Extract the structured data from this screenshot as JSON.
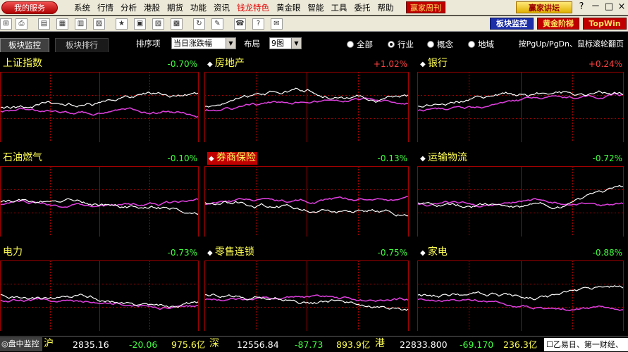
{
  "menubar": {
    "service_label": "我的服务",
    "items": [
      "系统",
      "行情",
      "分析",
      "港股",
      "期货",
      "功能",
      "资讯",
      "钱龙特色",
      "黄金眼",
      "智能",
      "工具",
      "委托",
      "帮助"
    ],
    "highlight_item": "钱龙特色",
    "weekly_label": "赢家周刊",
    "forum_label": "赢家讲坛",
    "help_glyph": "?",
    "min_glyph": "－",
    "max_glyph": "□",
    "close_glyph": "×"
  },
  "toolbar": {
    "board_monitor_label": "板块监控",
    "gold_ladder_label": "黄金阶梯",
    "topwin_label": "TopWin"
  },
  "filterbar": {
    "tab_monitor": "板块监控",
    "tab_rank": "板块排行",
    "sort_label": "排序项",
    "sort_value": "当日涨跌幅",
    "layout_label": "布局",
    "layout_value": "9图",
    "radio_all": "全部",
    "radio_industry": "行业",
    "radio_concept": "概念",
    "radio_region": "地域",
    "selected_radio": "行业",
    "hint": "按PgUp/PgDn、鼠标滚轮翻页"
  },
  "colors": {
    "up": "#ff4040",
    "down": "#40ff40",
    "title": "#ffff54",
    "grid": "#a00000",
    "sector_line": "#ffffff",
    "index_line": "#e040e0"
  },
  "panels": [
    {
      "name": "上证指数",
      "change": "-0.70%",
      "dir": "down",
      "diamond": false,
      "highlight": false
    },
    {
      "name": "房地产",
      "change": "+1.02%",
      "dir": "up",
      "diamond": true,
      "highlight": false
    },
    {
      "name": "银行",
      "change": "+0.24%",
      "dir": "up",
      "diamond": true,
      "highlight": false
    },
    {
      "name": "石油燃气",
      "change": "-0.10%",
      "dir": "down",
      "diamond": false,
      "highlight": false
    },
    {
      "name": "券商保险",
      "change": "-0.13%",
      "dir": "down",
      "diamond": true,
      "highlight": true
    },
    {
      "name": "运输物流",
      "change": "-0.72%",
      "dir": "down",
      "diamond": true,
      "highlight": false
    },
    {
      "name": "电力",
      "change": "-0.73%",
      "dir": "down",
      "diamond": false,
      "highlight": false
    },
    {
      "name": "零售连锁",
      "change": "-0.75%",
      "dir": "down",
      "diamond": true,
      "highlight": false
    },
    {
      "name": "家电",
      "change": "-0.88%",
      "dir": "down",
      "diamond": true,
      "highlight": false
    }
  ],
  "status": {
    "button_label": "盘中监控",
    "sh_mark": "沪",
    "sh_index": "2835.16",
    "sh_change": "-20.06",
    "sh_amount": "975.6亿",
    "sz_mark": "深",
    "sz_index": "12556.84",
    "sz_change": "-87.73",
    "sz_amount": "893.9亿",
    "hk_mark": "港",
    "hk_index": "22833.800",
    "hk_change": "-69.170",
    "hk_amount": "236.3亿",
    "news": "乙易日、第一财经、"
  }
}
